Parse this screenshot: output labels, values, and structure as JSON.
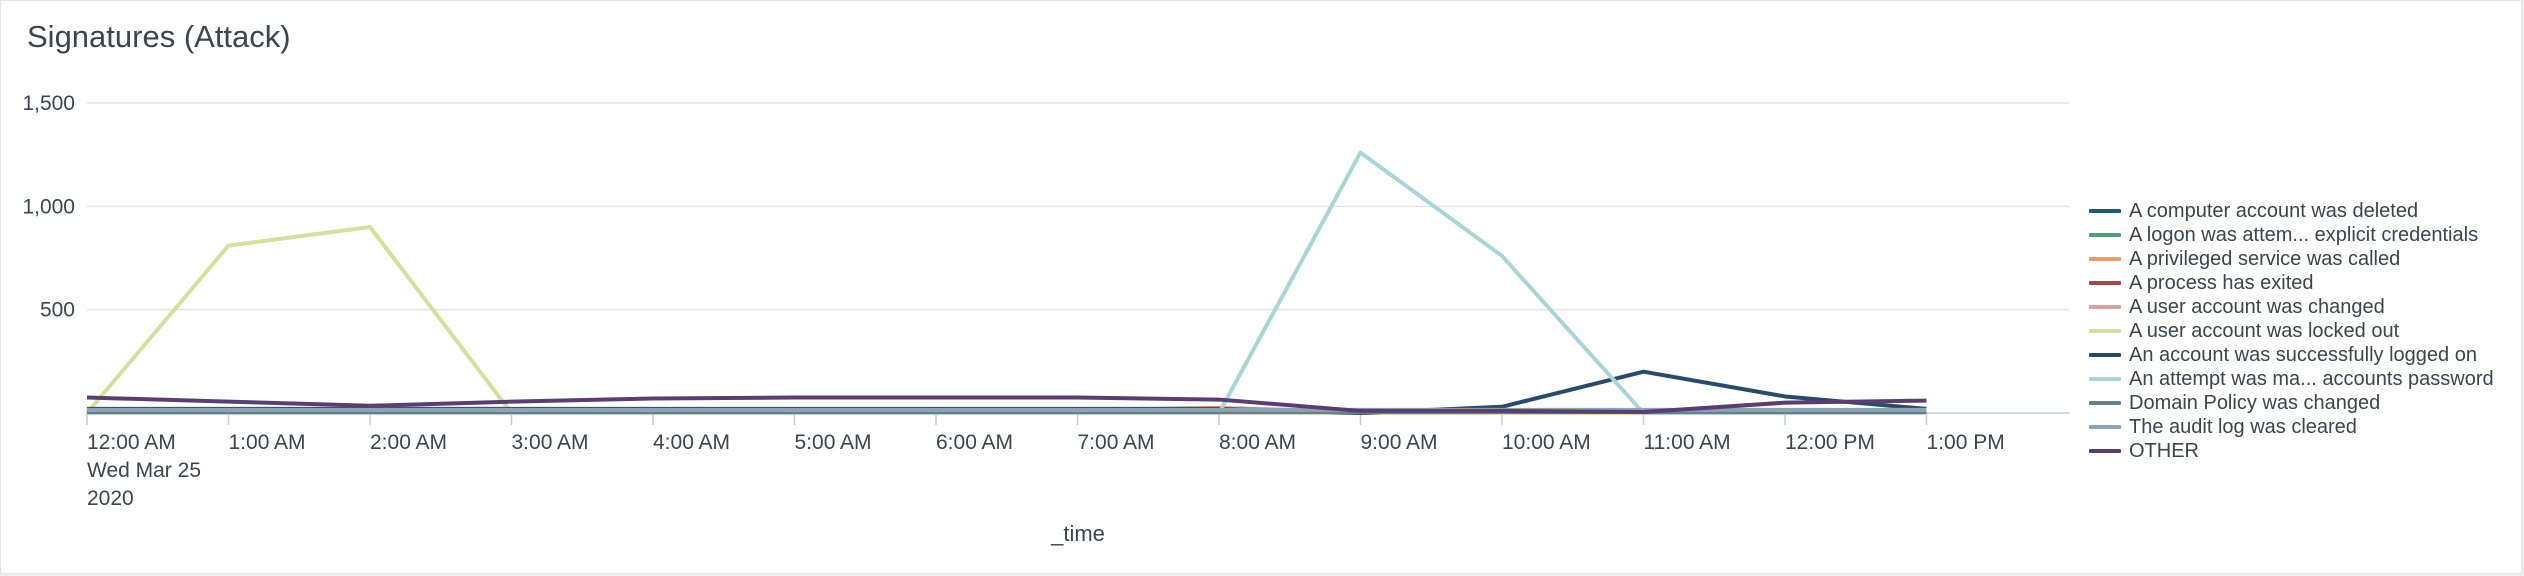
{
  "panel": {
    "title": "Signatures (Attack)"
  },
  "chart_data": {
    "type": "line",
    "title": "Signatures (Attack)",
    "xlabel": "_time",
    "ylabel": "",
    "ylim": [
      0,
      1500
    ],
    "y_ticks": [
      "500",
      "1,000",
      "1,500"
    ],
    "y_tick_values": [
      500,
      1000,
      1500
    ],
    "x": [
      "12:00 AM",
      "1:00 AM",
      "2:00 AM",
      "3:00 AM",
      "4:00 AM",
      "5:00 AM",
      "6:00 AM",
      "7:00 AM",
      "8:00 AM",
      "9:00 AM",
      "10:00 AM",
      "11:00 AM",
      "12:00 PM",
      "1:00 PM"
    ],
    "x_first_sub": [
      "Wed Mar 25",
      "2020"
    ],
    "grid": true,
    "legend_position": "right",
    "series": [
      {
        "name": "A computer account was deleted",
        "color": "#1f5c7a",
        "values": [
          5,
          5,
          5,
          5,
          5,
          5,
          5,
          5,
          5,
          5,
          5,
          5,
          5,
          5
        ]
      },
      {
        "name": "A logon was attem... explicit credentials",
        "color": "#4a9e7e",
        "values": [
          10,
          10,
          10,
          10,
          10,
          10,
          10,
          10,
          10,
          10,
          10,
          10,
          10,
          10
        ]
      },
      {
        "name": "A privileged service was called",
        "color": "#e79a6c",
        "values": [
          8,
          8,
          8,
          8,
          15,
          15,
          15,
          15,
          25,
          5,
          5,
          5,
          5,
          5
        ]
      },
      {
        "name": "A process has exited",
        "color": "#a8464d",
        "values": [
          3,
          3,
          3,
          3,
          3,
          3,
          3,
          3,
          3,
          3,
          3,
          3,
          3,
          3
        ]
      },
      {
        "name": "A user account was changed",
        "color": "#d9a1a1",
        "values": [
          2,
          2,
          2,
          2,
          2,
          2,
          2,
          2,
          2,
          2,
          2,
          2,
          2,
          2
        ]
      },
      {
        "name": "A user account was locked out",
        "color": "#d6df9e",
        "values": [
          0,
          810,
          900,
          0,
          0,
          0,
          0,
          0,
          0,
          0,
          0,
          0,
          0,
          0
        ]
      },
      {
        "name": "An account was successfully logged on",
        "color": "#294a6b",
        "values": [
          20,
          20,
          20,
          20,
          20,
          20,
          20,
          20,
          20,
          0,
          30,
          200,
          80,
          20
        ]
      },
      {
        "name": "An attempt was ma... accounts password",
        "color": "#a9d5d6",
        "values": [
          0,
          0,
          0,
          0,
          0,
          0,
          0,
          0,
          0,
          1260,
          760,
          0,
          0,
          0
        ]
      },
      {
        "name": "Domain Policy was changed",
        "color": "#6b7f88",
        "values": [
          5,
          5,
          5,
          5,
          5,
          5,
          5,
          5,
          5,
          5,
          5,
          5,
          5,
          5
        ]
      },
      {
        "name": "The audit log was cleared",
        "color": "#8fa3b7",
        "values": [
          15,
          15,
          15,
          15,
          15,
          15,
          15,
          15,
          15,
          15,
          15,
          15,
          15,
          15
        ]
      },
      {
        "name": "OTHER",
        "color": "#5a3e72",
        "values": [
          75,
          55,
          35,
          55,
          70,
          75,
          75,
          75,
          65,
          10,
          10,
          5,
          50,
          60
        ]
      }
    ]
  }
}
